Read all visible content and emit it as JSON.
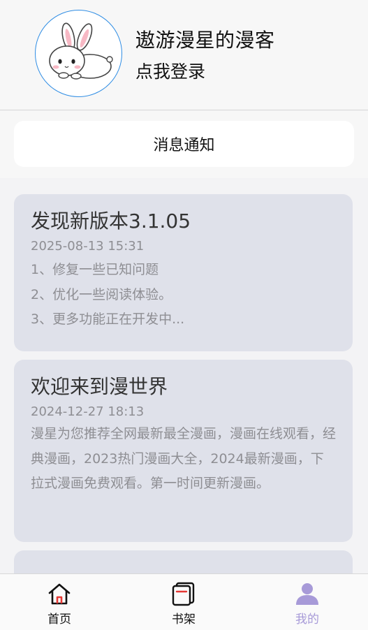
{
  "profile": {
    "username": "遨游漫星的漫客",
    "login_text": "点我登录",
    "avatar_icon": "bunny-avatar-icon"
  },
  "notice_button": {
    "label": "消息通知"
  },
  "messages": [
    {
      "title": "发现新版本3.1.05",
      "date": "2025-08-13 15:31",
      "lines": [
        "1、修复一些已知问题",
        "2、优化一些阅读体验。",
        "3、更多功能正在开发中..."
      ]
    },
    {
      "title": "欢迎来到漫世界",
      "date": "2024-12-27 18:13",
      "body": "漫星为您推荐全网最新最全漫画，漫画在线观看，经典漫画，2023热门漫画大全，2024最新漫画，下拉式漫画免费观看。第一时间更新漫画。"
    }
  ],
  "tabbar": {
    "tabs": [
      {
        "label": "首页",
        "icon": "home-icon",
        "active": false
      },
      {
        "label": "书架",
        "icon": "bookshelf-icon",
        "active": false
      },
      {
        "label": "我的",
        "icon": "profile-icon",
        "active": true
      }
    ]
  },
  "colors": {
    "accent": "#a79ad8",
    "avatar_border": "#2f8de4",
    "card_bg": "#dfe1ea",
    "home_icon_accent": "#e53935"
  }
}
